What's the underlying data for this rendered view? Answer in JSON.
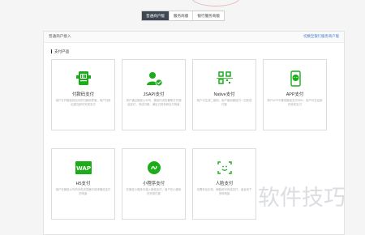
{
  "top_tabs": [
    {
      "label": "普通商户版"
    },
    {
      "label": "服务商版"
    },
    {
      "label": "银行服务商版"
    }
  ],
  "panel": {
    "title": "普通商户接入",
    "link": "切换至银行服务商户版"
  },
  "section": {
    "title": "支付产品"
  },
  "products": [
    {
      "label": "付款码支付",
      "desc": "用户打开微信钱包中的付款码界面，商户扫码后提交即可完成支付"
    },
    {
      "label": "JSAPI支付",
      "desc": "商户通过微信公众号、微信内浏览器等方式调起支付，完成付款，满足日常多种支付场景"
    },
    {
      "label": "Native支付",
      "desc": "商户可生成二维码，用户使用微信扫一扫完成付款"
    },
    {
      "label": "APP支付",
      "desc": "商户APP中集成微信支付SDK，用户可在应用内完成支付"
    },
    {
      "label": "H5支付",
      "desc": "用户在微信以外的手机浏览器中请求微信支付的场景"
    },
    {
      "label": "小程序支付",
      "desc": "在微信小程序中接入微信支付，用户在小程序内完成付款"
    },
    {
      "label": "人脸支付",
      "desc": "无需拿出手机，刷脸即可完成支付，适合线下多种场景"
    }
  ],
  "colors": {
    "wechat_green": "#1aad19",
    "tab_active": "#3e4752"
  },
  "watermark": {
    "text": "软件技巧"
  }
}
